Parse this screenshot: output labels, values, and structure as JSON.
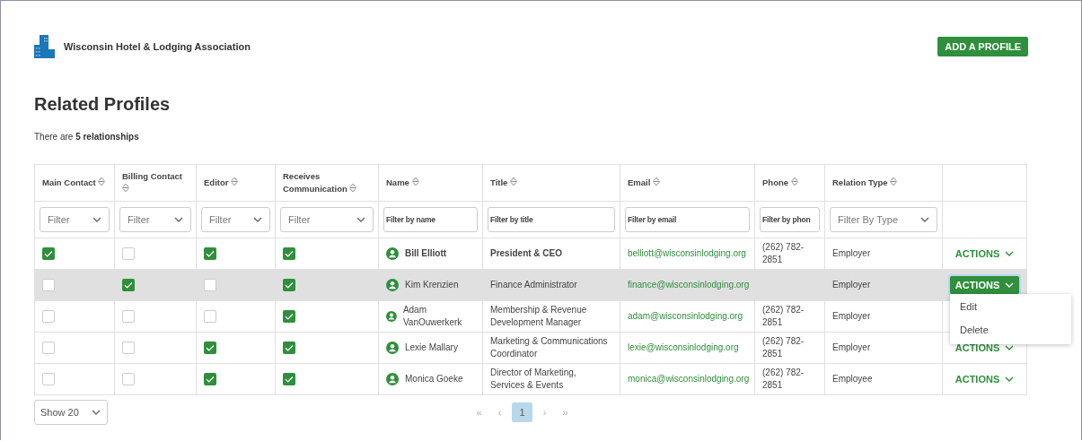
{
  "header": {
    "org_name": "Wisconsin Hotel & Lodging Association",
    "add_button": "ADD A PROFILE"
  },
  "page_title": "Related Profiles",
  "summary": "There are **5 relationships**",
  "table": {
    "columns": [
      {
        "label": "Main Contact"
      },
      {
        "label": "Billing Contact"
      },
      {
        "label": "Editor"
      },
      {
        "label": "Receives Communication"
      },
      {
        "label": "Name"
      },
      {
        "label": "Title"
      },
      {
        "label": "Email"
      },
      {
        "label": "Phone"
      },
      {
        "label": "Relation Type"
      }
    ],
    "filters": [
      {
        "kind": "select",
        "placeholder": "Filter"
      },
      {
        "kind": "select",
        "placeholder": "Filter"
      },
      {
        "kind": "select",
        "placeholder": "Filter"
      },
      {
        "kind": "select",
        "placeholder": "Filter"
      },
      {
        "kind": "text",
        "placeholder": "Filter by name"
      },
      {
        "kind": "text",
        "placeholder": "Filter by title"
      },
      {
        "kind": "text",
        "placeholder": "Filter by email"
      },
      {
        "kind": "text",
        "placeholder": "Filter by phon"
      },
      {
        "kind": "select",
        "placeholder": "Filter By Type"
      }
    ],
    "rows": [
      {
        "main_contact": true,
        "billing_contact": false,
        "editor": true,
        "receives_communication": true,
        "name": "Bill Elliott",
        "title": "President & CEO",
        "email": "belliott@wisconsinlodging.org",
        "phone": "(262) 782-2851",
        "relation_type": "Employer",
        "emphasized": true,
        "selected": false,
        "actions": {
          "label": "ACTIONS",
          "open": false
        }
      },
      {
        "main_contact": false,
        "billing_contact": true,
        "editor": false,
        "receives_communication": true,
        "name": "Kim Krenzien",
        "title": "Finance Administrator",
        "email": "finance@wisconsinlodging.org",
        "relation_type": "Employer",
        "emphasized": false,
        "selected": true,
        "actions": {
          "label": "ACTIONS",
          "open": true,
          "menu_items": [
            "Edit",
            "Delete"
          ]
        }
      },
      {
        "main_contact": false,
        "billing_contact": false,
        "editor": false,
        "receives_communication": true,
        "name": "Adam VanOuwerkerk",
        "title": "Membership & Revenue Development Manager",
        "email": "adam@wisconsinlodging.org",
        "phone": "(262) 782-2851",
        "relation_type": "Employer",
        "emphasized": false,
        "selected": false
      },
      {
        "main_contact": false,
        "billing_contact": false,
        "editor": true,
        "receives_communication": true,
        "name": "Lexie Mallary",
        "title": "Marketing & Communications Coordinator",
        "email": "lexie@wisconsinlodging.org",
        "phone": "(262) 782-2851",
        "relation_type": "Employer",
        "emphasized": false,
        "selected": false,
        "actions": {
          "label": "ACTIONS",
          "open": false
        }
      },
      {
        "main_contact": false,
        "billing_contact": false,
        "editor": true,
        "receives_communication": true,
        "name": "Monica Goeke",
        "title": "Director of Marketing, Services & Events",
        "email": "monica@wisconsinlodging.org",
        "phone": "(262) 782-2851",
        "relation_type": "Employee",
        "emphasized": false,
        "selected": false,
        "actions": {
          "label": "ACTIONS",
          "open": false
        }
      }
    ]
  },
  "footer": {
    "page_size": "Show 20",
    "pagination": {
      "first": "«",
      "prev": "‹",
      "pages": [
        {
          "label": "1",
          "selected": true
        }
      ],
      "next": "›",
      "last": "»"
    }
  }
}
